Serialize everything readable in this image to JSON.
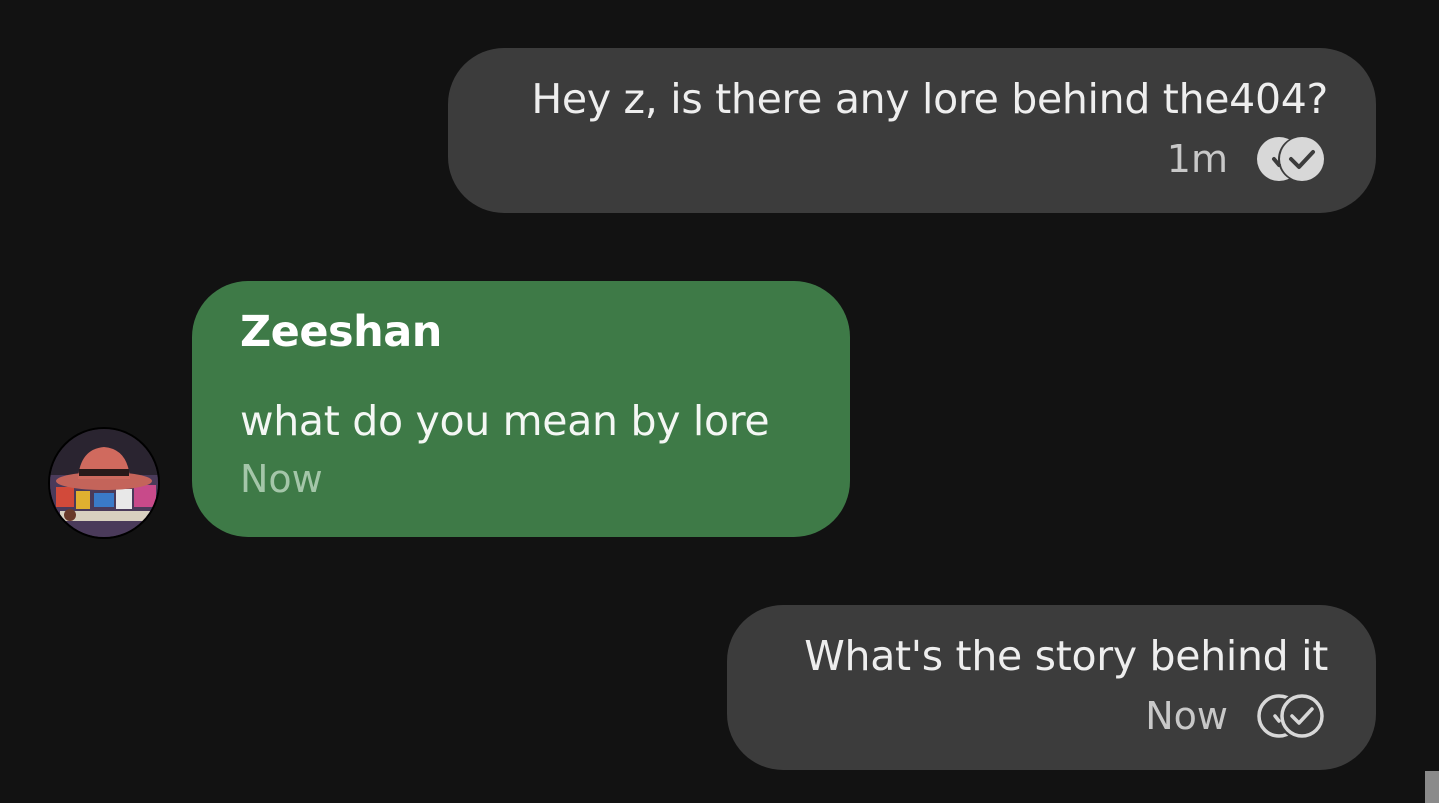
{
  "messages": [
    {
      "direction": "outgoing",
      "text": "Hey z, is there any lore behind the404?",
      "time": "1m",
      "receipt": "read-filled-icon"
    },
    {
      "direction": "incoming",
      "sender": "Zeeshan",
      "text": "what do you mean by lore",
      "time": "Now",
      "avatar": "avatar-hat-photo"
    },
    {
      "direction": "outgoing",
      "text": "What's the story behind it",
      "time": "Now",
      "receipt": "delivered-outline-icon"
    }
  ],
  "colors": {
    "background": "#121212",
    "outgoing_bubble": "#3c3c3c",
    "incoming_bubble": "#3e7a47"
  }
}
